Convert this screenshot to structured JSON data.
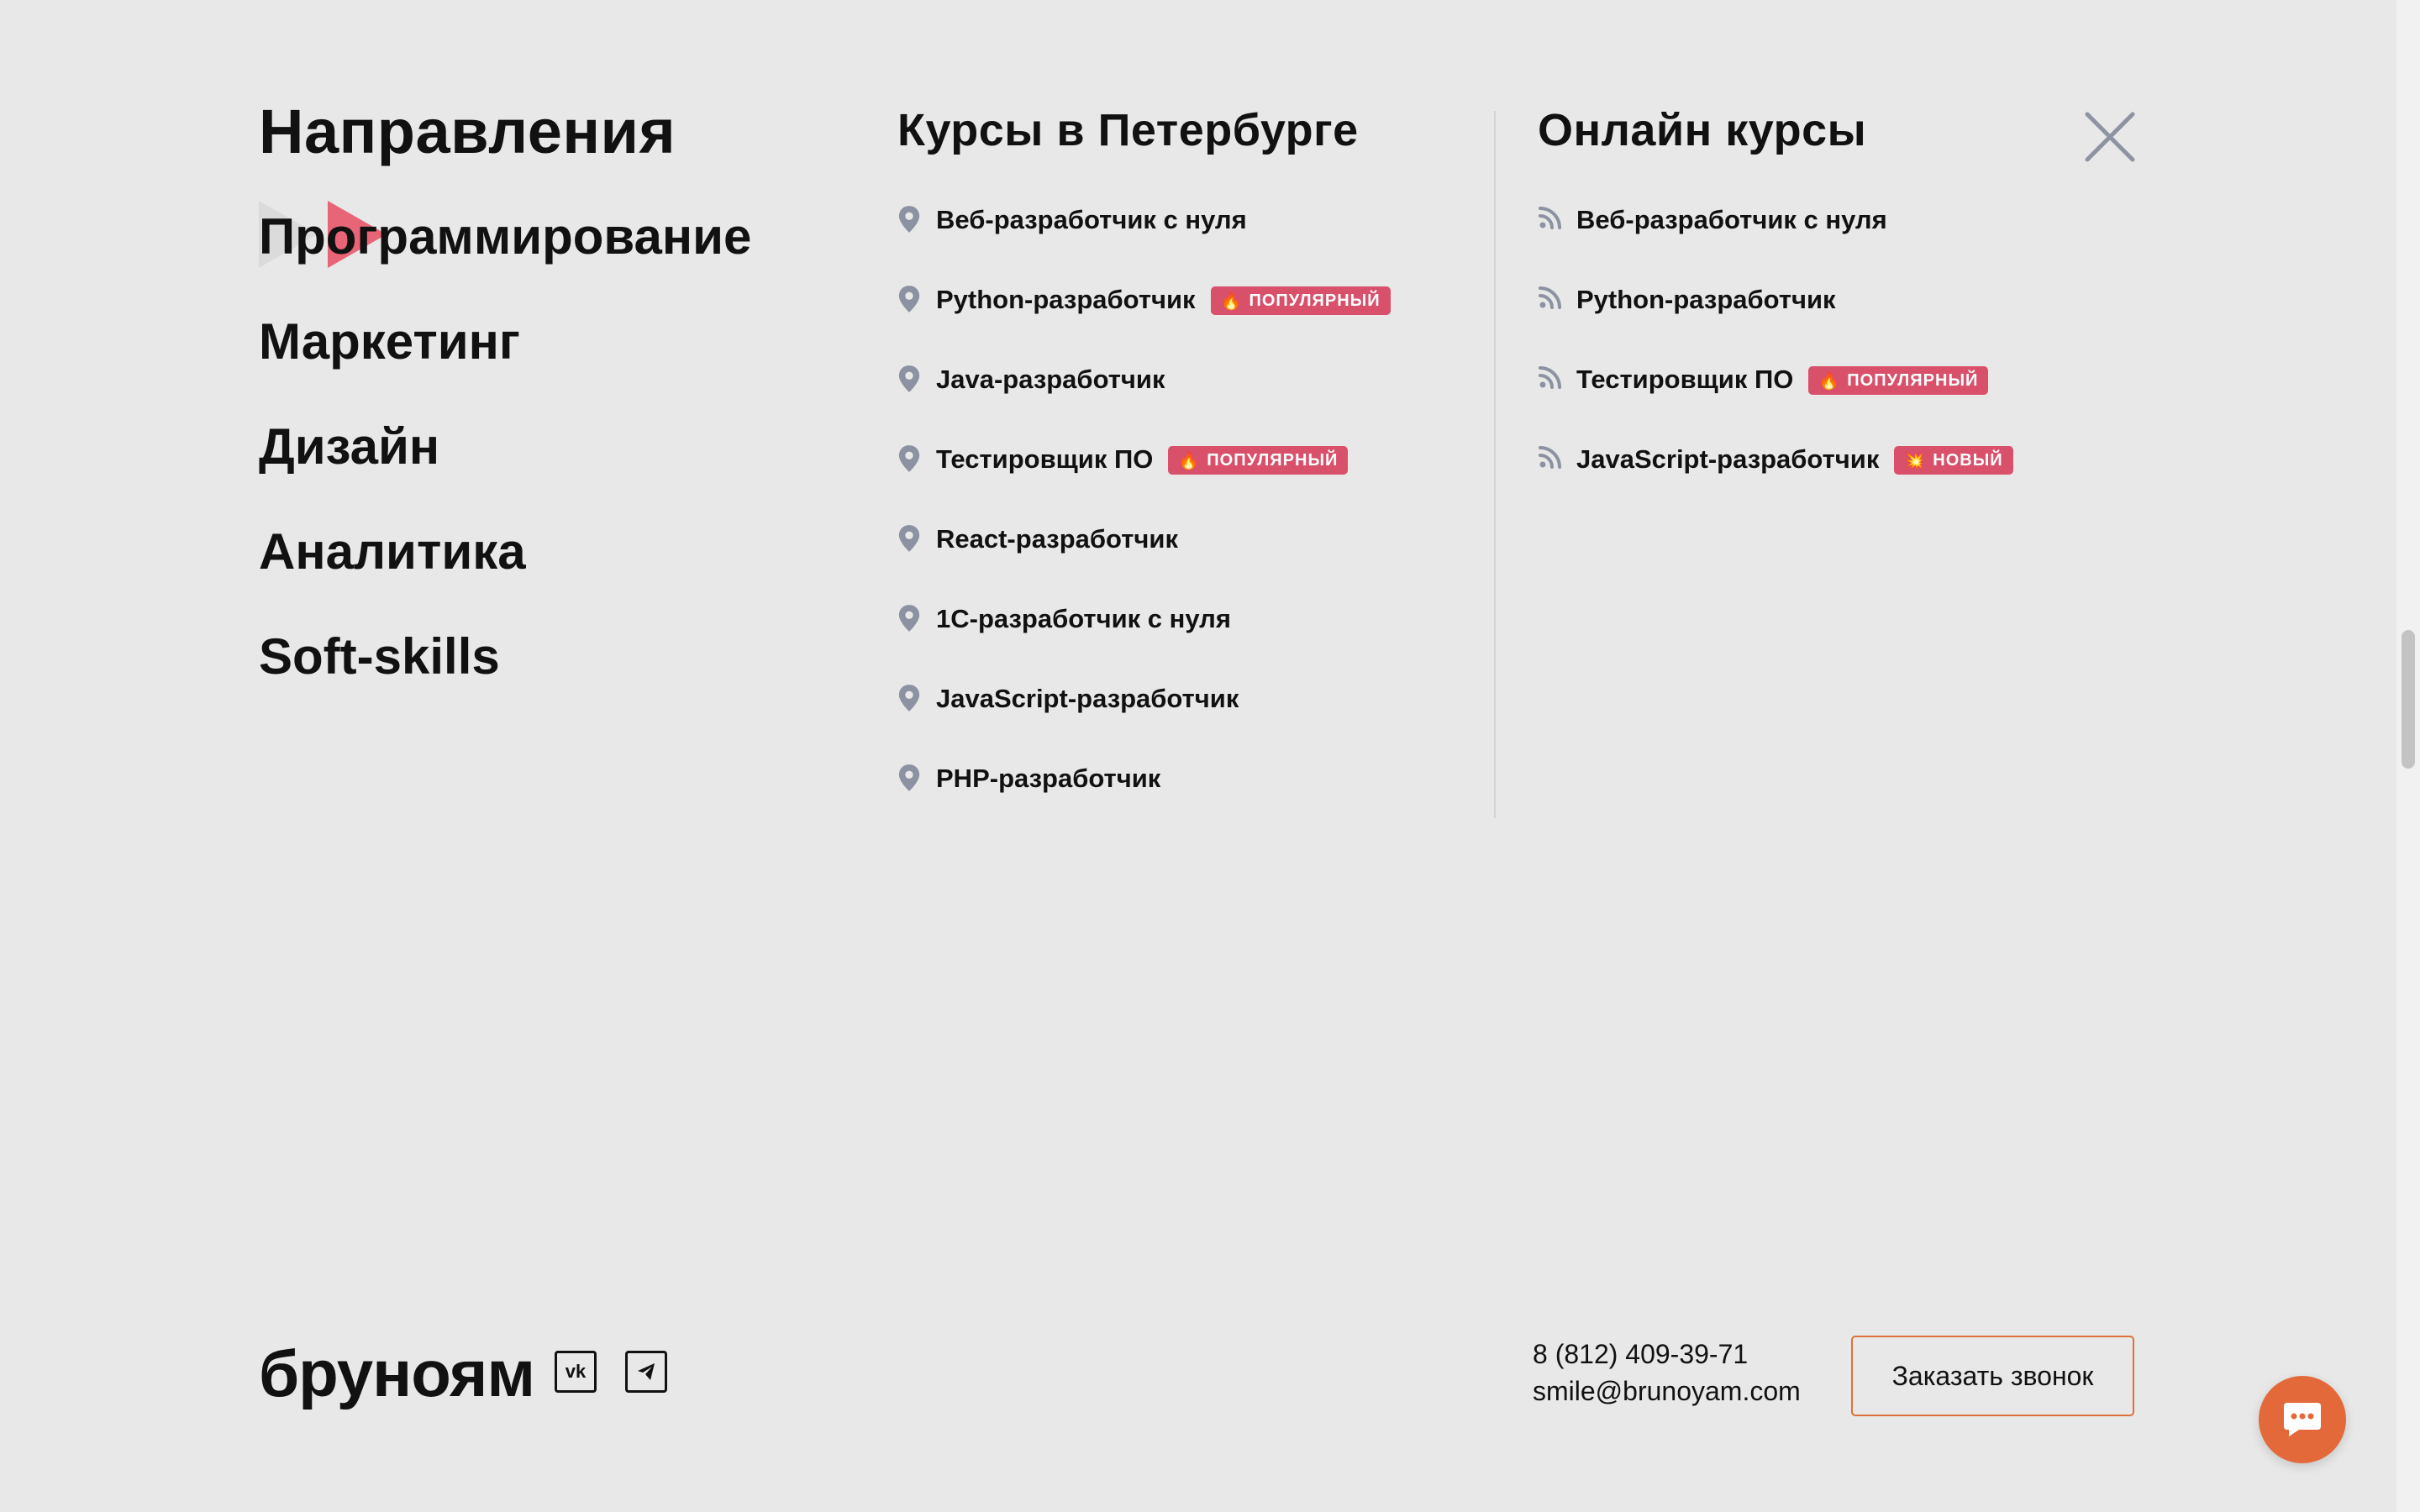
{
  "directions": {
    "title": "Направления",
    "items": [
      {
        "label": "Программирование",
        "active": true
      },
      {
        "label": "Маркетинг"
      },
      {
        "label": "Дизайн"
      },
      {
        "label": "Аналитика"
      },
      {
        "label": "Soft-skills"
      }
    ]
  },
  "spb": {
    "title": "Курсы в Петербурге",
    "icon": "location-pin-icon",
    "courses": [
      {
        "label": "Веб-разработчик с нуля"
      },
      {
        "label": "Python-разработчик",
        "badge": "ПОПУЛЯРНЫЙ",
        "badge_icon": "🔥"
      },
      {
        "label": "Java-разработчик"
      },
      {
        "label": "Тестировщик ПО",
        "badge": "ПОПУЛЯРНЫЙ",
        "badge_icon": "🔥"
      },
      {
        "label": "React-разработчик"
      },
      {
        "label": "1С-разработчик с нуля"
      },
      {
        "label": "JavaScript-разработчик"
      },
      {
        "label": "PHP-разработчик"
      }
    ]
  },
  "online": {
    "title": "Онлайн курсы",
    "icon": "rss-feed-icon",
    "courses": [
      {
        "label": "Веб-разработчик с нуля"
      },
      {
        "label": "Python-разработчик"
      },
      {
        "label": "Тестировщик ПО",
        "badge": "ПОПУЛЯРНЫЙ",
        "badge_icon": "🔥"
      },
      {
        "label": "JavaScript-разработчик",
        "badge": "НОВЫЙ",
        "badge_icon": "💥"
      }
    ]
  },
  "footer": {
    "logo": "бруноям",
    "social": [
      {
        "name": "vk-icon",
        "glyph": "vk"
      },
      {
        "name": "telegram-icon",
        "glyph": "➤"
      }
    ],
    "phone": "8 (812) 409-39-71",
    "email": "smile@brunoyam.com",
    "call_button": "Заказать звонок"
  },
  "colors": {
    "accent": "#e4693a",
    "badge": "#d9506b",
    "background": "#e8e8e8"
  }
}
